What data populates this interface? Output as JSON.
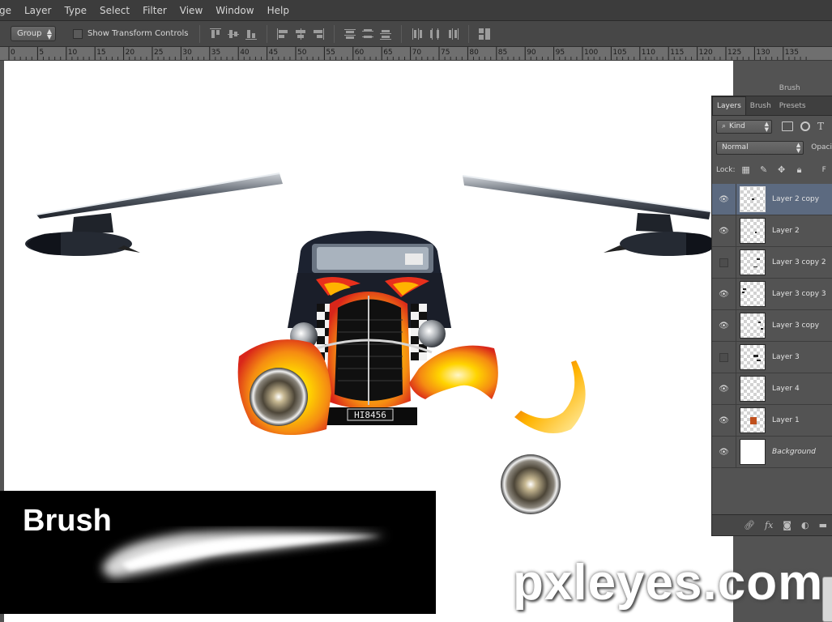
{
  "menu": {
    "items": [
      "ge",
      "Layer",
      "Type",
      "Select",
      "Filter",
      "View",
      "Window",
      "Help"
    ]
  },
  "options": {
    "auto_select_value": "Group",
    "transform_label": "Show Transform Controls"
  },
  "ruler": {
    "ticks": [
      "0",
      "5",
      "10",
      "15",
      "20",
      "25",
      "30",
      "35",
      "40",
      "45",
      "50",
      "55",
      "60",
      "65",
      "70",
      "75",
      "80",
      "85",
      "90",
      "95",
      "100",
      "105",
      "110",
      "115",
      "120",
      "125",
      "130",
      "135"
    ]
  },
  "layers_panel": {
    "tabs": [
      "Layers",
      "Brush",
      "Brush Presets"
    ],
    "filter_value": "Kind",
    "blend_mode": "Normal",
    "opacity_label": "Opaci",
    "lock_label": "Lock:",
    "fill_label": "F",
    "layers": [
      {
        "name": "Layer 2 copy",
        "visible": true,
        "selected": true
      },
      {
        "name": "Layer 2",
        "visible": true,
        "selected": false
      },
      {
        "name": "Layer 3 copy 2",
        "visible": false,
        "selected": false
      },
      {
        "name": "Layer 3 copy 3",
        "visible": true,
        "selected": false
      },
      {
        "name": "Layer 3 copy",
        "visible": true,
        "selected": false
      },
      {
        "name": "Layer 3",
        "visible": false,
        "selected": false
      },
      {
        "name": "Layer 4",
        "visible": true,
        "selected": false
      },
      {
        "name": "Layer 1",
        "visible": true,
        "selected": false
      },
      {
        "name": "Background",
        "visible": true,
        "selected": false
      }
    ]
  },
  "overlay": {
    "brush_title": "Brush",
    "watermark": "pxleyes.com",
    "plate_text": "HI8456"
  },
  "colors": {
    "selected_layer": "#5c6a80",
    "flame_yellow": "#ffd400",
    "flame_red": "#e8301c"
  }
}
